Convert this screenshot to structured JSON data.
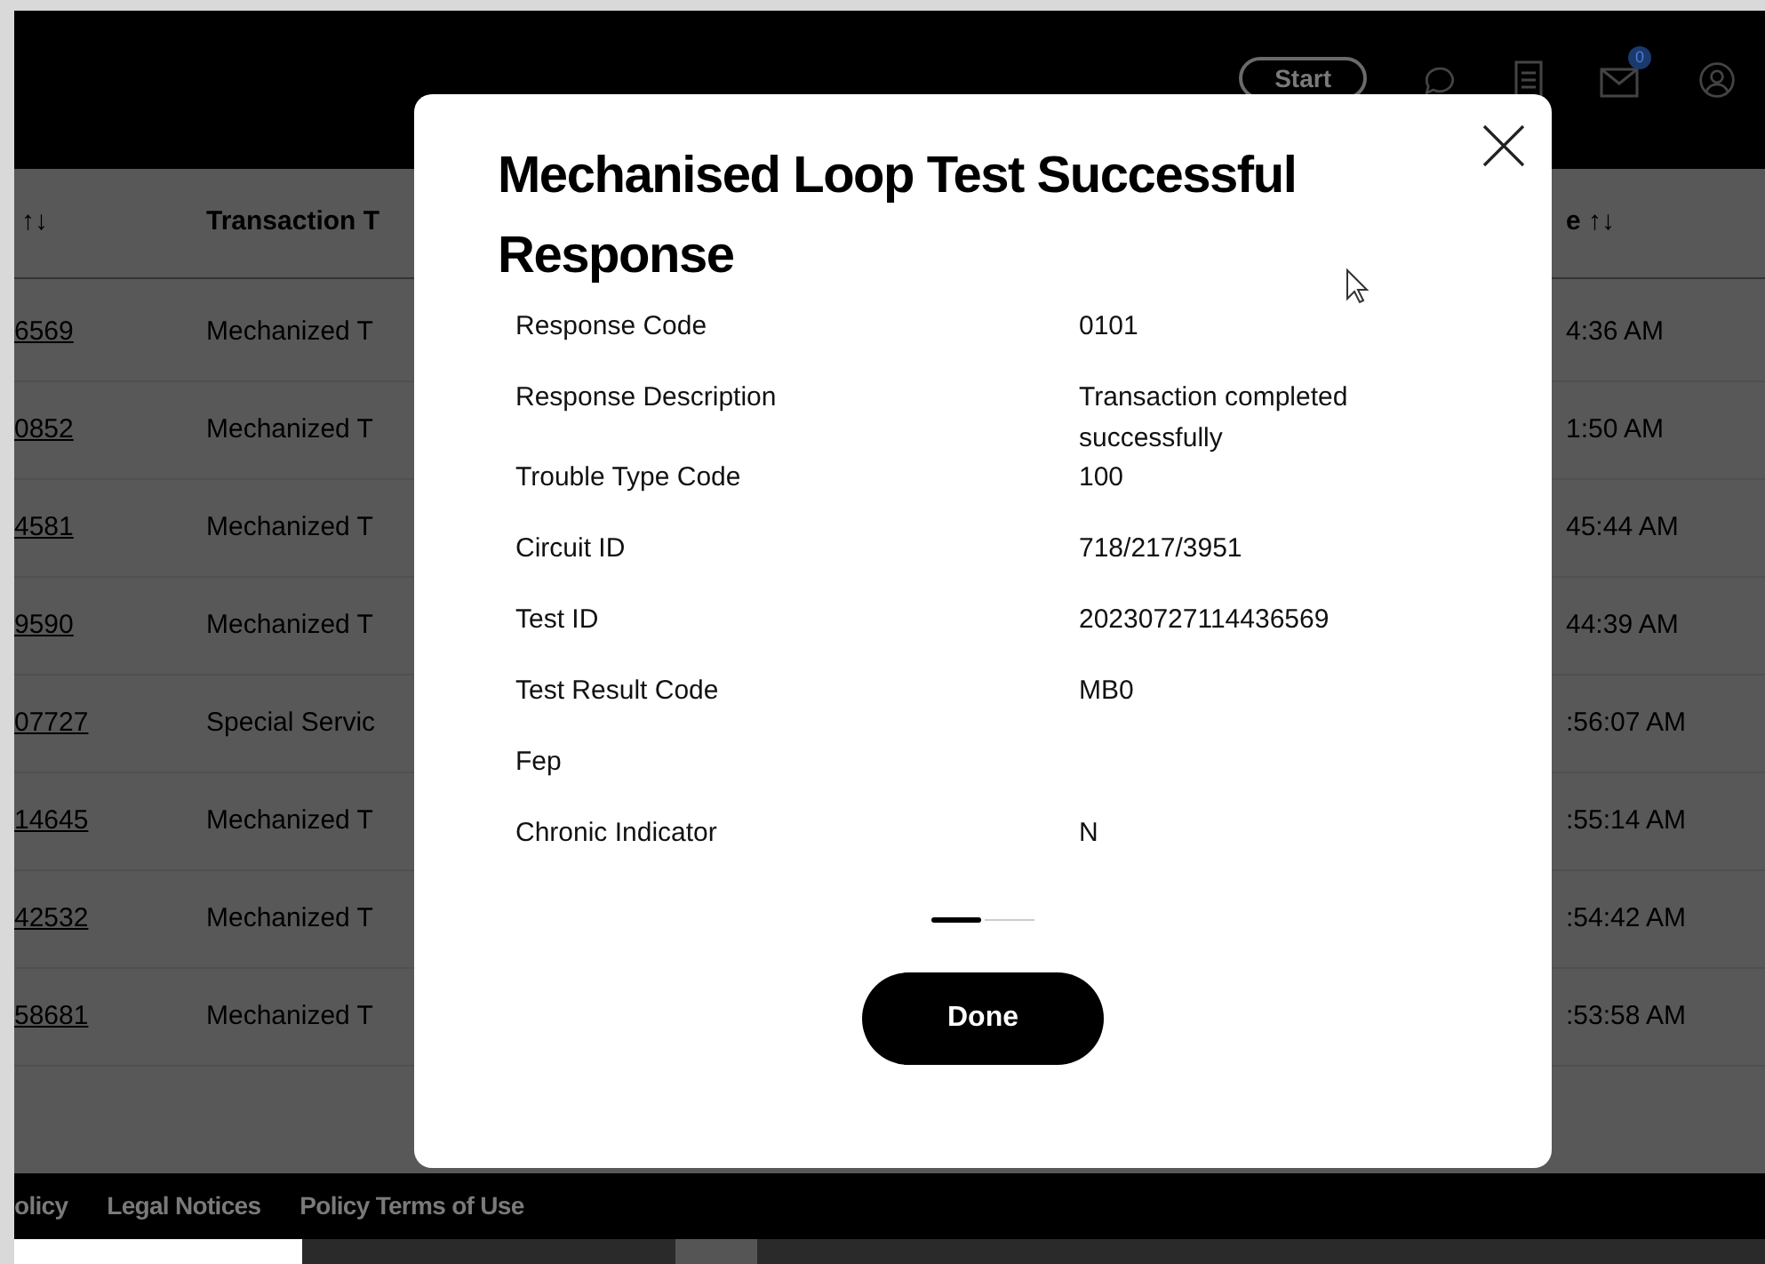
{
  "header": {
    "start_button": "Start",
    "mail_badge": "0"
  },
  "table": {
    "columns": [
      "↑↓",
      "Transaction T",
      "e ↑↓"
    ],
    "rows": [
      {
        "id": "6569",
        "type": "Mechanized T",
        "time": "4:36 AM"
      },
      {
        "id": "0852",
        "type": "Mechanized T",
        "time": "1:50 AM"
      },
      {
        "id": "4581",
        "type": "Mechanized T",
        "time": "45:44 AM"
      },
      {
        "id": "9590",
        "type": "Mechanized T",
        "time": "44:39 AM"
      },
      {
        "id": "07727",
        "type": "Special Servic",
        "time": ":56:07 AM"
      },
      {
        "id": "14645",
        "type": "Mechanized T",
        "time": ":55:14 AM"
      },
      {
        "id": "42532",
        "type": "Mechanized T",
        "time": ":54:42 AM"
      },
      {
        "id": "58681",
        "type": "Mechanized T",
        "time": ":53:58 AM"
      }
    ]
  },
  "modal": {
    "title": "Mechanised Loop Test Successful Response",
    "fields": [
      {
        "label": "Response Code",
        "value": "0101"
      },
      {
        "label": "Response Description",
        "value": "Transaction completed successfully"
      },
      {
        "label": "Trouble Type Code",
        "value": "100"
      },
      {
        "label": "Circuit ID",
        "value": "718/217/3951"
      },
      {
        "label": "Test ID",
        "value": "20230727114436569"
      },
      {
        "label": "Test Result Code",
        "value": "MB0"
      },
      {
        "label": "Fep"
      },
      {
        "label": "Chronic Indicator",
        "value": "N"
      }
    ],
    "pager": [
      {
        "selected": true
      },
      {
        "selected": false
      }
    ],
    "done_button": "Done"
  },
  "footer": {
    "links": [
      "olicy",
      "Legal Notices",
      "Policy Terms of Use"
    ]
  }
}
